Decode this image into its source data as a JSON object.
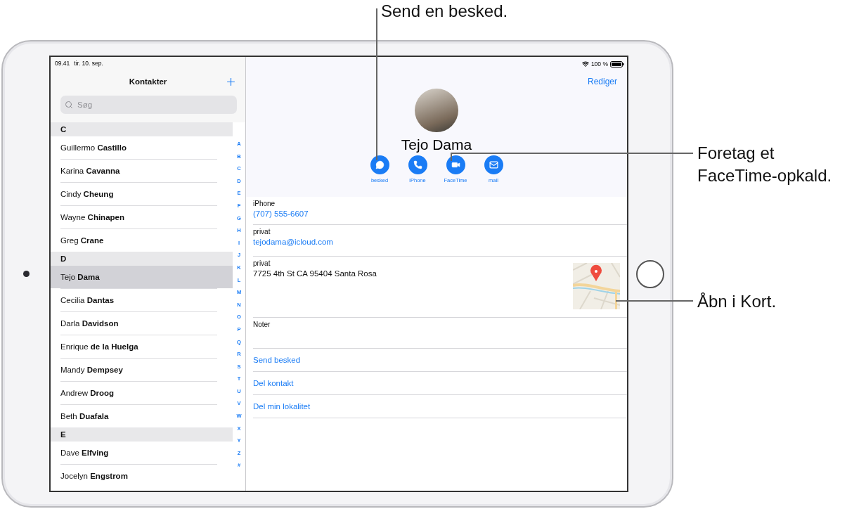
{
  "callouts": [
    {
      "text": "Send en besked."
    },
    {
      "text": "Foretag et FaceTime-opkald."
    },
    {
      "text": "Åbn i Kort."
    }
  ],
  "status_bar": {
    "time": "09.41",
    "date": "tir. 10. sep.",
    "battery": "100 %"
  },
  "sidebar": {
    "title": "Kontakter",
    "search": {
      "placeholder": "Søg"
    },
    "sections": [
      {
        "letter": "C",
        "contacts": [
          {
            "first": "Guillermo",
            "last": "Castillo",
            "selected": false
          },
          {
            "first": "Karina",
            "last": "Cavanna",
            "selected": false
          },
          {
            "first": "Cindy",
            "last": "Cheung",
            "selected": false
          },
          {
            "first": "Wayne",
            "last": "Chinapen",
            "selected": false
          },
          {
            "first": "Greg",
            "last": "Crane",
            "selected": false
          }
        ]
      },
      {
        "letter": "D",
        "contacts": [
          {
            "first": "Tejo",
            "last": "Dama",
            "selected": true
          },
          {
            "first": "Cecilia",
            "last": "Dantas",
            "selected": false
          },
          {
            "first": "Darla",
            "last": "Davidson",
            "selected": false
          },
          {
            "first": "Enrique",
            "last": "de la Huelga",
            "selected": false
          },
          {
            "first": "Mandy",
            "last": "Dempsey",
            "selected": false
          },
          {
            "first": "Andrew",
            "last": "Droog",
            "selected": false
          },
          {
            "first": "Beth",
            "last": "Duafala",
            "selected": false
          }
        ]
      },
      {
        "letter": "E",
        "contacts": [
          {
            "first": "Dave",
            "last": "Elfving",
            "selected": false
          },
          {
            "first": "Jocelyn",
            "last": "Engstrom",
            "selected": false
          }
        ]
      }
    ],
    "index": [
      "A",
      "B",
      "C",
      "D",
      "E",
      "F",
      "G",
      "H",
      "I",
      "J",
      "K",
      "L",
      "M",
      "N",
      "O",
      "P",
      "Q",
      "R",
      "S",
      "T",
      "U",
      "V",
      "W",
      "X",
      "Y",
      "Z",
      "#"
    ]
  },
  "detail": {
    "edit": "Rediger",
    "name": "Tejo Dama",
    "actions": [
      {
        "kind": "message",
        "label": "besked"
      },
      {
        "kind": "phone",
        "label": "iPhone"
      },
      {
        "kind": "video",
        "label": "FaceTime"
      },
      {
        "kind": "mail",
        "label": "mail"
      }
    ],
    "fields": [
      {
        "kind": "link",
        "label": "iPhone",
        "value": "(707) 555-6607"
      },
      {
        "kind": "link",
        "label": "privat",
        "value": "tejodama@icloud.com"
      },
      {
        "kind": "address",
        "label": "privat",
        "value": "7725 4th St CA 95404 Santa Rosa"
      },
      {
        "kind": "notes",
        "label": "Noter"
      }
    ],
    "links": [
      "Send besked",
      "Del kontakt",
      "Del min lokalitet"
    ]
  }
}
